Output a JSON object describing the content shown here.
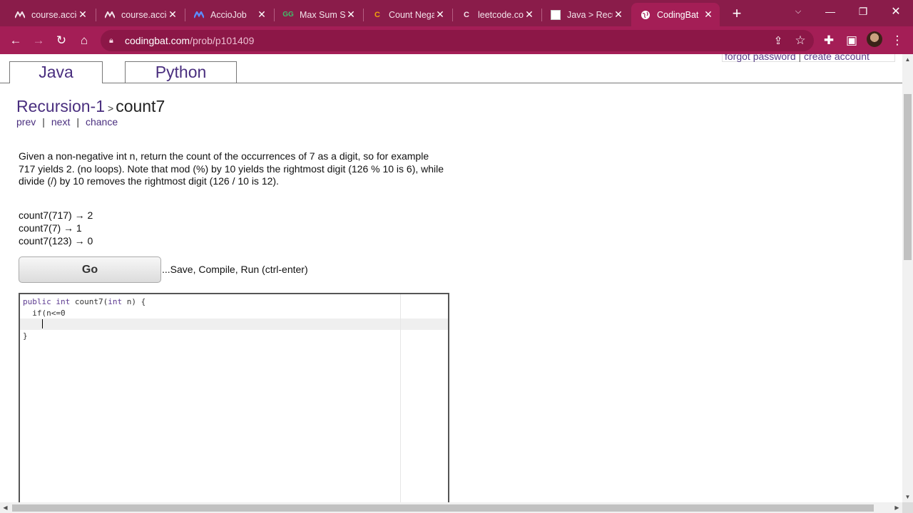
{
  "browser": {
    "tabs": [
      {
        "title": "course.accio",
        "favicon": "accio-icon"
      },
      {
        "title": "course.accio",
        "favicon": "accio-icon"
      },
      {
        "title": "AccioJob",
        "favicon": "acciojob-icon"
      },
      {
        "title": "Max Sum S",
        "favicon": "gfg-icon"
      },
      {
        "title": "Count Nega",
        "favicon": "leetcode-icon"
      },
      {
        "title": "leetcode.co",
        "favicon": "leetcode-icon"
      },
      {
        "title": "Java > Recu",
        "favicon": "codingbat-page-icon"
      },
      {
        "title": "CodingBat",
        "favicon": "globe-icon"
      }
    ],
    "active_tab_index": 7,
    "url_host": "codingbat.com",
    "url_path": "/prob/p101409",
    "colors": {
      "tabstrip": "#8a1c4a",
      "toolbar": "#a41e56"
    }
  },
  "page": {
    "login": {
      "forgot": "forgot password",
      "sep": "|",
      "create": "create account"
    },
    "lang_tabs": [
      "Java",
      "Python"
    ],
    "active_lang": "Java",
    "breadcrumb": {
      "parent": "Recursion-1",
      "gt": ">",
      "current": "count7"
    },
    "nav": {
      "prev": "prev",
      "next": "next",
      "chance": "chance",
      "sep": "|"
    },
    "description": "Given a non-negative int n, return the count of the occurrences of 7 as a digit, so for example 717 yields 2. (no loops). Note that mod (%) by 10 yields the rightmost digit (126 % 10 is 6), while divide (/) by 10 removes the rightmost digit (126 / 10 is 12).",
    "examples": [
      "count7(717) → 2",
      "count7(7) → 1",
      "count7(123) → 0"
    ],
    "go_button": "Go",
    "go_hint": "...Save, Compile, Run (ctrl-enter)",
    "code": {
      "kw_public": "public",
      "kw_int": "int",
      "method": "count7(",
      "kw_int2": "int",
      "params": "n) {",
      "line2": "  if(n<=0",
      "line4": "}"
    }
  }
}
